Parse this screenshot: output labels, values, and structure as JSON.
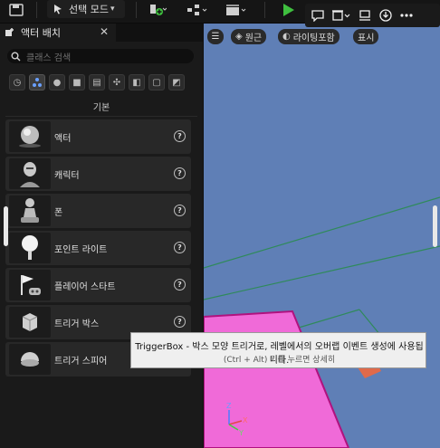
{
  "toolbar": {
    "mode_label": "선택 모드",
    "icons": [
      "save-icon",
      "mode-icon",
      "add-actor-icon",
      "blueprint-icon",
      "cinematics-icon",
      "play-icon"
    ]
  },
  "panel": {
    "tab_label": "액터 배치",
    "close_glyph": "✕",
    "search_placeholder": "클래스 검색",
    "category_heading": "기본",
    "categories": [
      "recently-placed",
      "basic",
      "lights",
      "shapes",
      "cinematic",
      "visual-effects",
      "geometry",
      "volumes",
      "all-classes"
    ],
    "items": [
      {
        "label": "액터",
        "icon": "sphere-icon"
      },
      {
        "label": "캐릭터",
        "icon": "character-icon"
      },
      {
        "label": "폰",
        "icon": "pawn-icon"
      },
      {
        "label": "포인트 라이트",
        "icon": "point-light-icon"
      },
      {
        "label": "플레이어 스타트",
        "icon": "player-start-icon"
      },
      {
        "label": "트리거 박스",
        "icon": "trigger-box-icon"
      },
      {
        "label": "트리거 스피어",
        "icon": "trigger-sphere-icon"
      }
    ],
    "help_glyph": "?"
  },
  "viewport": {
    "menu_glyph": "☰",
    "perspective_label": "원근",
    "lighting_label": "라이팅포함",
    "show_label": "표시"
  },
  "tooltip": {
    "line1": "TriggerBox - 박스 모양 트리거로, 레벨에서의 오버랩 이벤트 생성에 사용됩니다.",
    "line2": "(Ctrl + Alt) 키를 누르면 상세히"
  },
  "colors": {
    "viewport_bg": "#5f7fb6",
    "magenta_plane": "#f06ad8",
    "play_green": "#3fbf3f"
  }
}
